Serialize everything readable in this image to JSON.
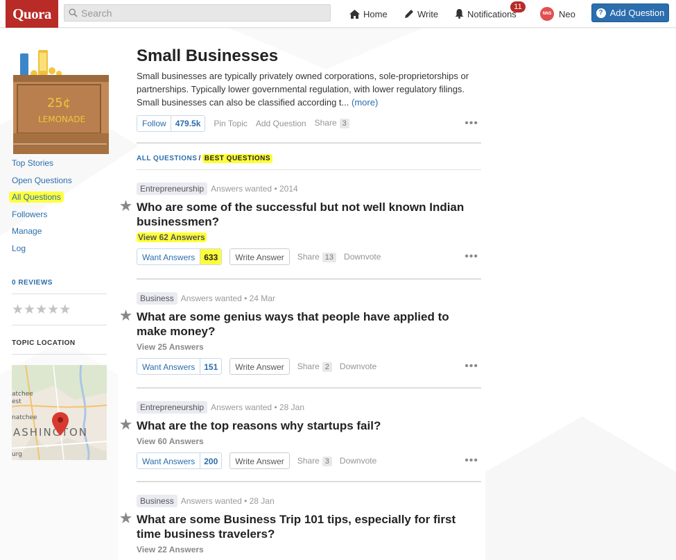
{
  "header": {
    "logo": "Quora",
    "search_placeholder": "Search",
    "nav": {
      "home": "Home",
      "write": "Write",
      "notifications": "Notifications",
      "notifications_count": "11",
      "user_initials": "NNS",
      "user_name": "Neo"
    },
    "add_question": "Add Question"
  },
  "sidebar": {
    "links": [
      "Top Stories",
      "Open Questions",
      "All Questions",
      "Followers",
      "Manage",
      "Log"
    ],
    "active_link": "All Questions",
    "reviews_heading": "0 REVIEWS",
    "rating_stars": 0,
    "location_heading": "TOPIC LOCATION",
    "topic_image_text": {
      "line1": "25¢",
      "line2": "LEMONADE"
    },
    "map_labels": {
      "state": "ASHINGTON",
      "city1": "atchee",
      "city2": "est",
      "city3": "natchee",
      "city4": "urg"
    }
  },
  "topic": {
    "title": "Small Businesses",
    "description": "Small businesses are typically privately owned corporations, sole-proprietorships or partnerships. Typically lower governmental regulation, with lower regulatory filings. Small businesses can also be classified according t...",
    "more": "(more)",
    "follow_label": "Follow",
    "follow_count": "479.5k",
    "pin_topic": "Pin Topic",
    "add_question": "Add Question",
    "share": "Share",
    "share_count": "3"
  },
  "filter": {
    "all": "ALL QUESTIONS",
    "separator": "/",
    "best": "BEST QUESTIONS"
  },
  "questions": [
    {
      "tag": "Entrepreneurship",
      "meta": "Answers wanted • 2014",
      "title": "Who are some of the successful but not well known Indian businessmen?",
      "view": "View 62 Answers",
      "want_label": "Want Answers",
      "want_count": "633",
      "write_label": "Write Answer",
      "share_label": "Share",
      "share_count": "13",
      "downvote": "Downvote"
    },
    {
      "tag": "Business",
      "meta": "Answers wanted • 24 Mar",
      "title": "What are some genius ways that people have applied to make money?",
      "view": "View 25 Answers",
      "want_label": "Want Answers",
      "want_count": "151",
      "write_label": "Write Answer",
      "share_label": "Share",
      "share_count": "2",
      "downvote": "Downvote"
    },
    {
      "tag": "Entrepreneurship",
      "meta": "Answers wanted • 28 Jan",
      "title": "What are the top reasons why startups fail?",
      "view": "View 60 Answers",
      "want_label": "Want Answers",
      "want_count": "200",
      "write_label": "Write Answer",
      "share_label": "Share",
      "share_count": "3",
      "downvote": "Downvote"
    },
    {
      "tag": "Business",
      "meta": "Answers wanted • 28 Jan",
      "title": "What are some Business Trip 101 tips, especially for first time business travelers?",
      "view": "View 22 Answers"
    }
  ],
  "colors": {
    "brand": "#b92b27",
    "link": "#2b6dad",
    "highlight": "#ffff38"
  }
}
